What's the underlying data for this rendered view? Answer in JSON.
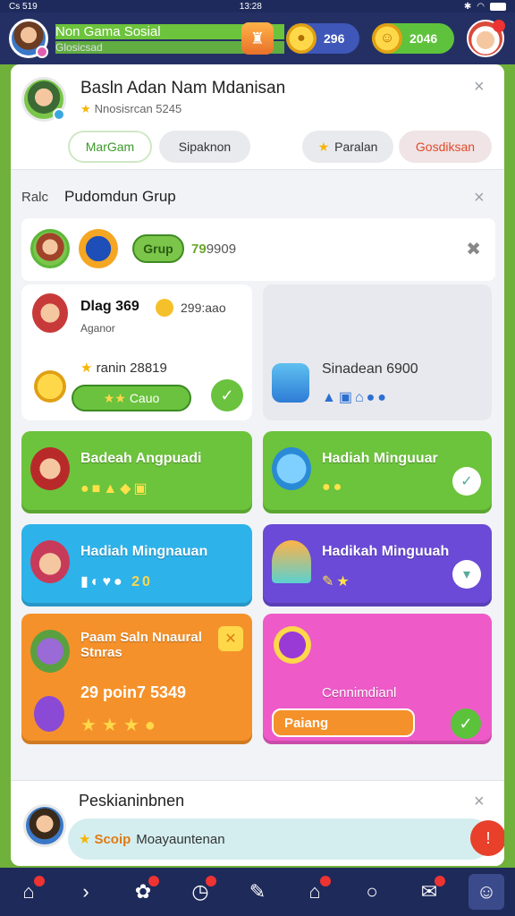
{
  "statusbar": {
    "left": "Cs 519",
    "time": "13:28"
  },
  "header": {
    "title": "Non Gama Sosial",
    "subtitle": "Glosicsad",
    "coins_blue": "296",
    "coins_green": "2046"
  },
  "profile": {
    "name": "Basln Adan Nam Mdanisan",
    "rating": "Nnosisrcan 5245",
    "chips": [
      "MarGam",
      "Sipaknon",
      "Paralan",
      "Gosdiksan"
    ]
  },
  "section": {
    "prefix": "Ralc",
    "title": "Pudomdun Grup"
  },
  "group": {
    "button": "Grup",
    "count_highlight": "79",
    "count_rest": "9909"
  },
  "user_card": {
    "name": "Dlag 369",
    "value": "299:aao",
    "sub": "Aganor",
    "rank": "ranin 28819",
    "button": "Cauo"
  },
  "sina_card": {
    "title": "Sinadean 6900"
  },
  "tiles": [
    {
      "label": "Badeah Angpuadi"
    },
    {
      "label": "Hadiah Minguuar"
    },
    {
      "label": "Hadiah Mingnauan",
      "number": "20"
    },
    {
      "label": "Hadikah Minguuah"
    },
    {
      "label": "Paam Saln Nnaural Stnras",
      "points": "29 poin7 5349"
    },
    {
      "label": "Cennimdianl",
      "button": "Paiang"
    }
  ],
  "bottom": {
    "title": "Peskianinbnen",
    "highlight": "Scoip",
    "text": "Moayauntenan"
  }
}
